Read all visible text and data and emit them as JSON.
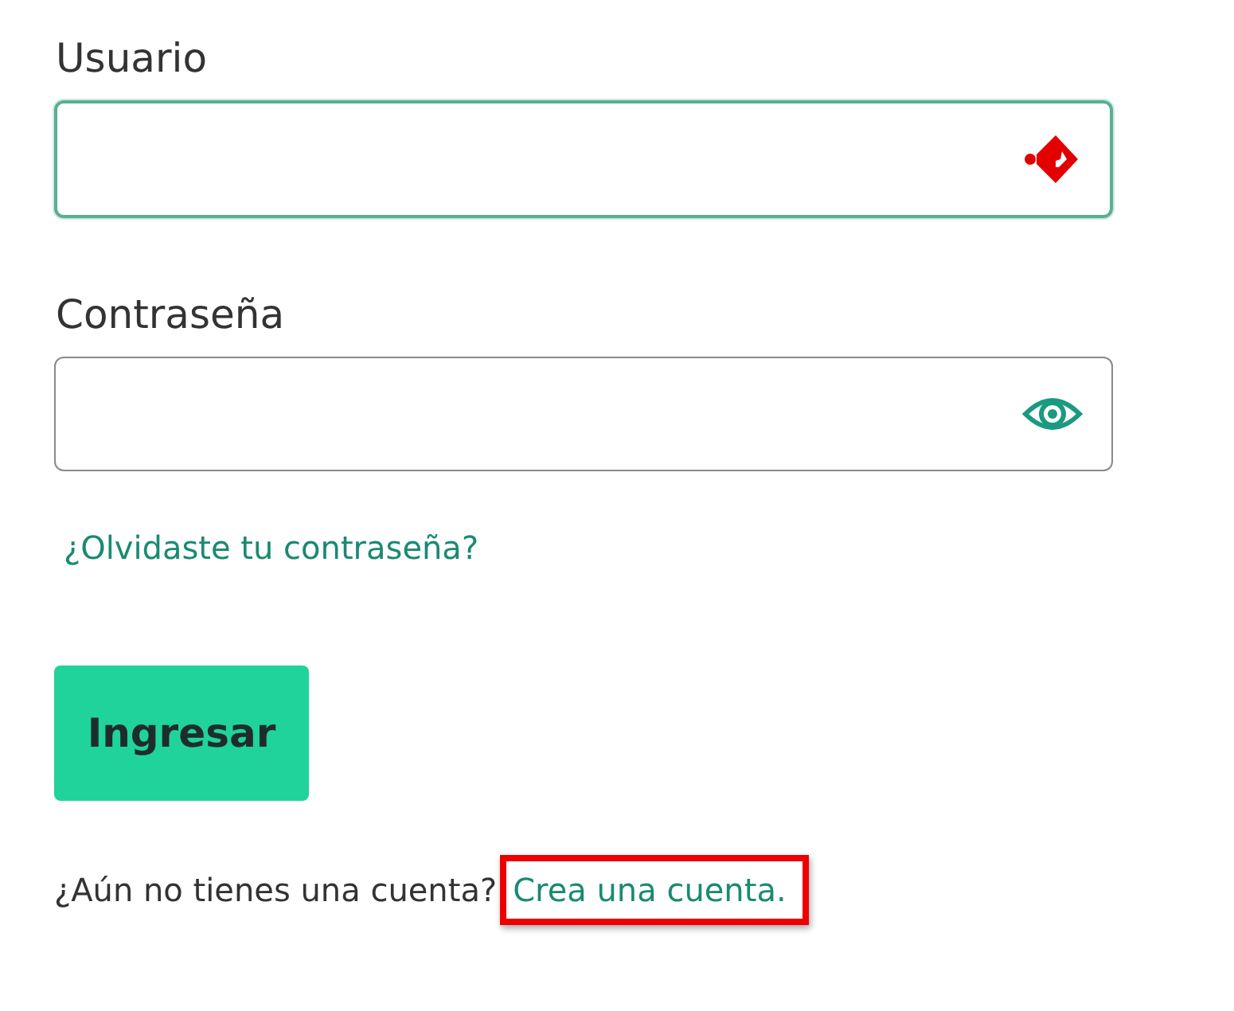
{
  "username": {
    "label": "Usuario",
    "focused": true
  },
  "password": {
    "label": "Contraseña"
  },
  "forgot_link": "¿Olvidaste tu contraseña?",
  "submit_button": "Ingresar",
  "signup": {
    "prompt": "¿Aún no tienes una cuenta?",
    "link": "Crea una cuenta.",
    "highlighted": true
  }
}
